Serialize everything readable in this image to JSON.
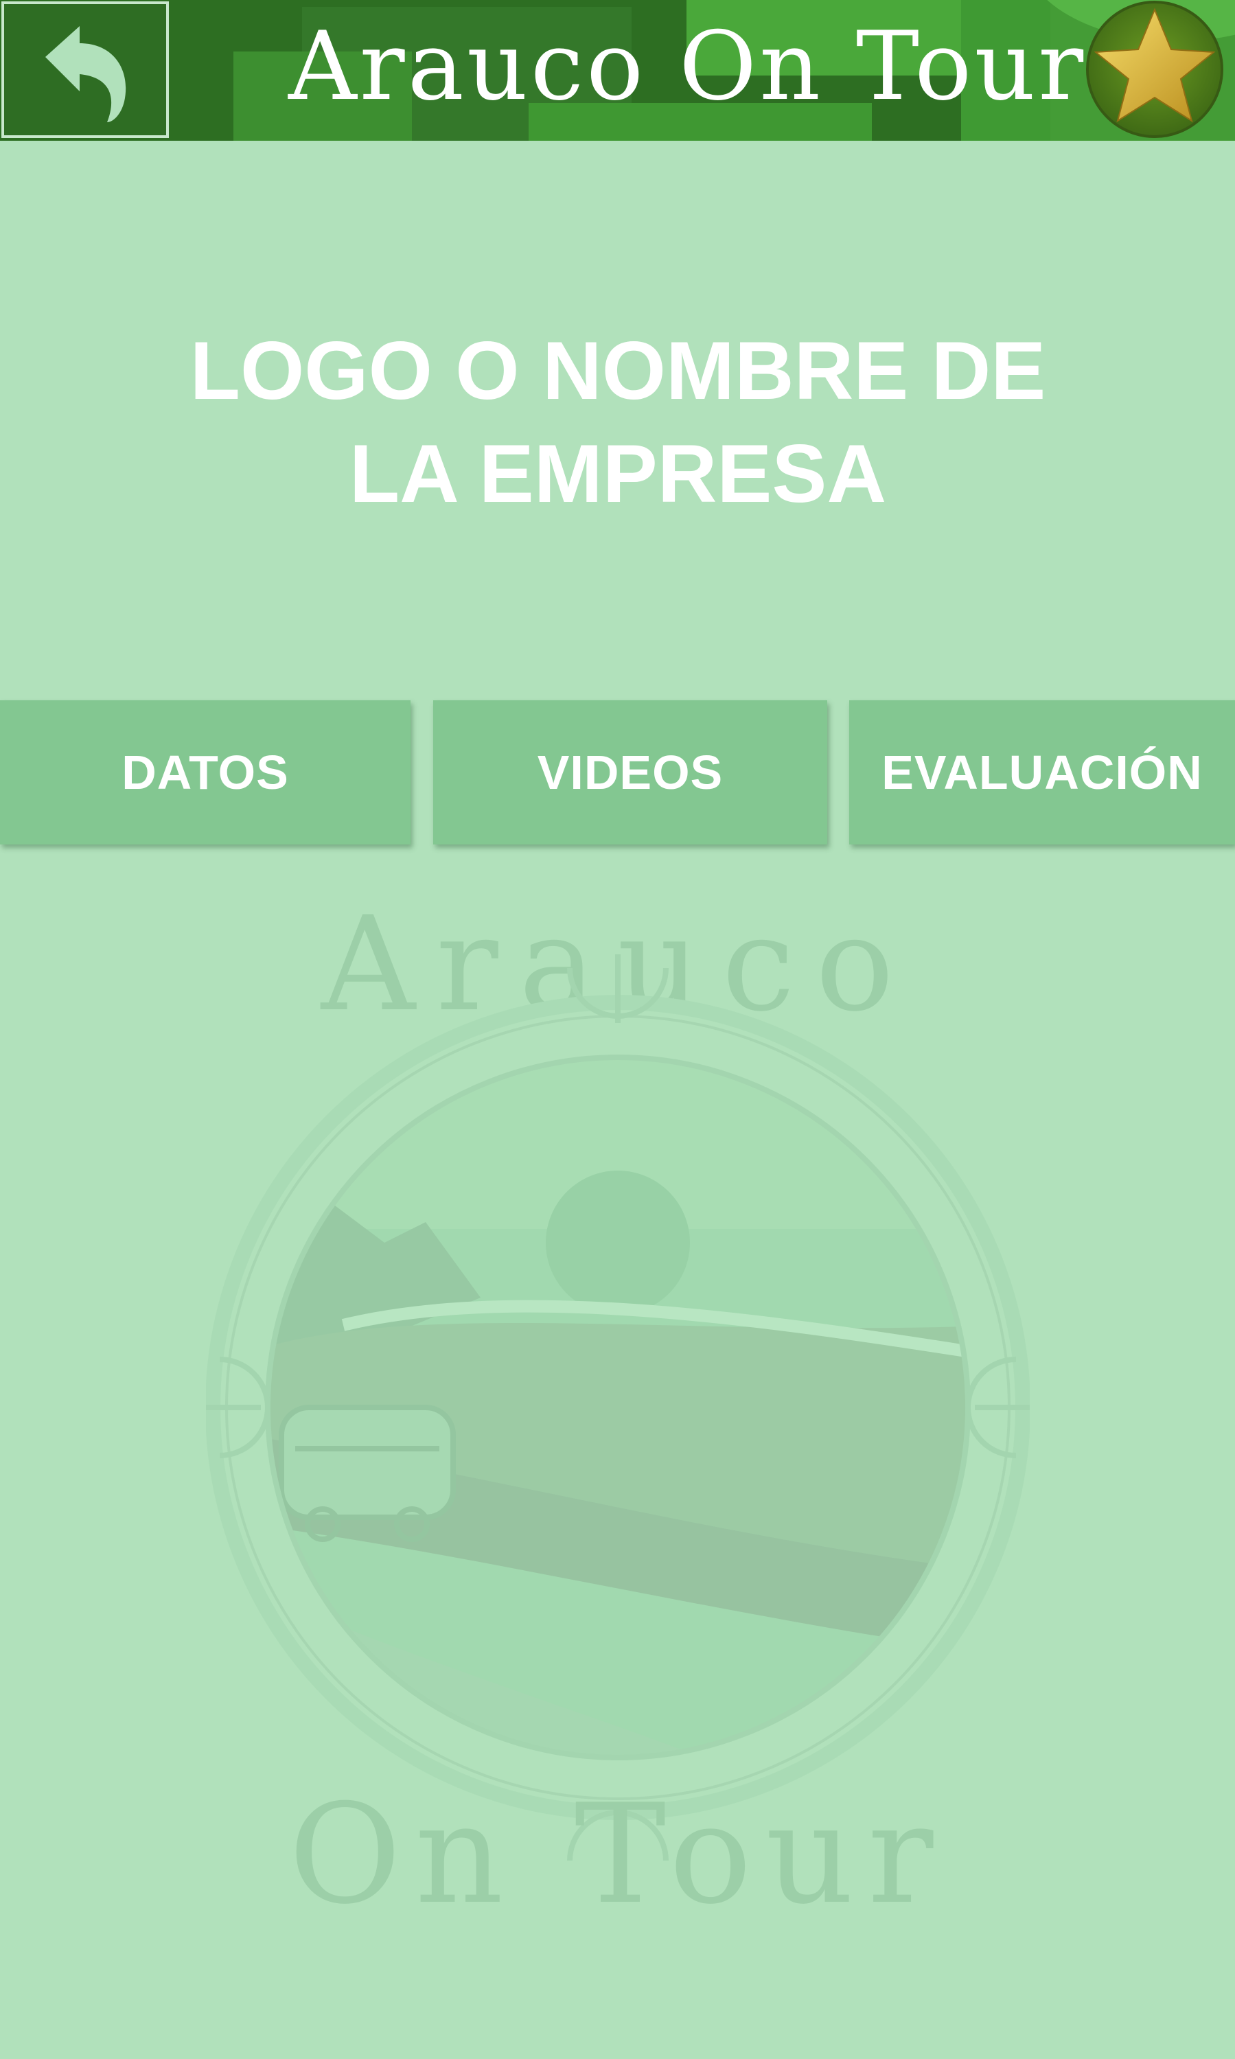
{
  "header": {
    "title": "Arauco On Tour",
    "back_icon": "back-arrow-icon",
    "favorite_icon": "star-icon",
    "colors": {
      "dark": "#2d6e22",
      "mid": "#3a8a2c",
      "light": "#4aa83a"
    }
  },
  "main": {
    "company_placeholder_line1": "LOGO O NOMBRE DE",
    "company_placeholder_line2": "LA EMPRESA"
  },
  "tabs": [
    {
      "label": "DATOS"
    },
    {
      "label": "VIDEOS"
    },
    {
      "label": "EVALUACIÓN"
    }
  ],
  "watermark": {
    "top_text": "Arauco",
    "bottom_text": "On Tour"
  },
  "colors": {
    "background": "#b1e1bb",
    "tab": "#83c791",
    "text": "#ffffff"
  }
}
